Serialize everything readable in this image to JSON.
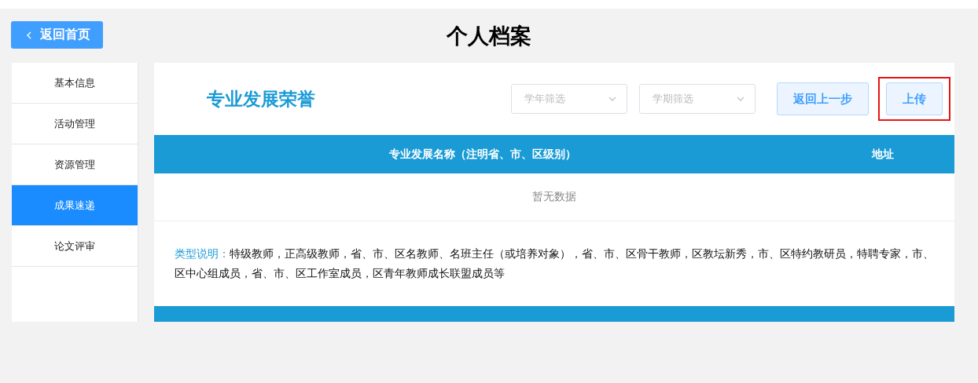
{
  "back_button": {
    "label": "返回首页"
  },
  "page_title": "个人档案",
  "sidebar": {
    "items": [
      {
        "label": "基本信息",
        "selected": false
      },
      {
        "label": "活动管理",
        "selected": false
      },
      {
        "label": "资源管理",
        "selected": false
      },
      {
        "label": "成果速递",
        "selected": true
      },
      {
        "label": "论文评审",
        "selected": false
      }
    ]
  },
  "section_title": "专业发展荣誉",
  "filters": [
    {
      "placeholder": "学年筛选"
    },
    {
      "placeholder": "学期筛选"
    }
  ],
  "buttons": [
    {
      "label": "返回上一步",
      "highlighted": false
    },
    {
      "label": "上传",
      "highlighted": true
    }
  ],
  "table": {
    "columns": [
      "专业发展名称（注明省、市、区级别）",
      "地址"
    ],
    "empty_text": "暂无数据"
  },
  "note": {
    "label": "类型说明：",
    "text": "特级教师，正高级教师，省、市、区名教师、名班主任（或培养对象），省、市、区骨干教师，区教坛新秀，市、区特约教研员，特聘专家，市、区中心组成员，省、市、区工作室成员，区青年教师成长联盟成员等"
  }
}
